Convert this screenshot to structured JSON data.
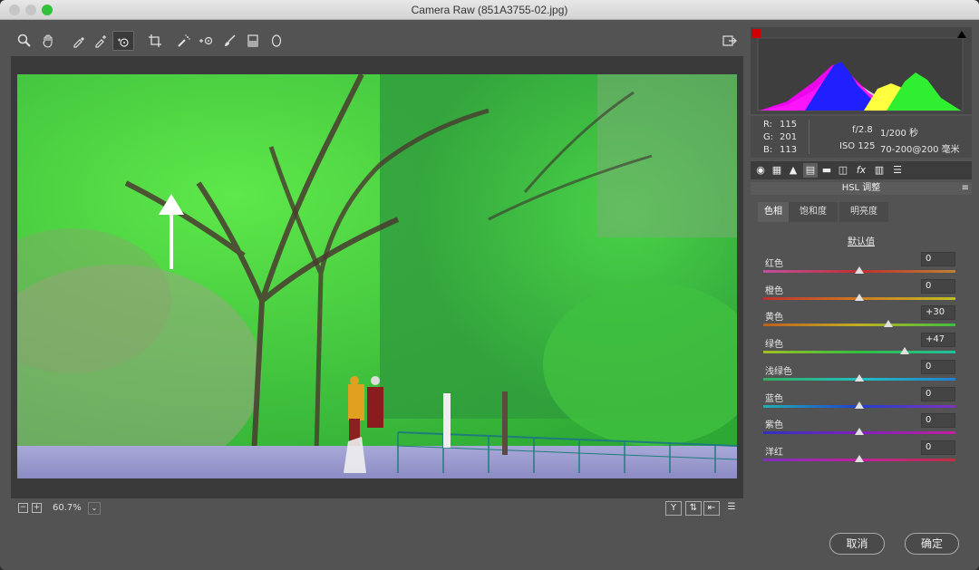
{
  "window": {
    "title": "Camera Raw (851A3755-02.jpg)"
  },
  "toolbar": {
    "tools": [
      "zoom-tool",
      "hand-tool",
      "white-balance-tool",
      "color-sampler-tool",
      "targeted-adjustment-tool",
      "crop-tool",
      "spot-removal-tool",
      "red-eye-tool",
      "adjustment-brush-tool",
      "graduated-filter-tool",
      "radial-filter-tool"
    ],
    "export_icon": "open-export-icon"
  },
  "status": {
    "zoom": "60.7%",
    "zoom_out": "−",
    "zoom_in": "+",
    "compare_y": "Y"
  },
  "readout": {
    "r_label": "R:",
    "r": "115",
    "g_label": "G:",
    "g": "201",
    "b_label": "B:",
    "b": "113",
    "aperture": "f/2.8",
    "shutter": "1/200 秒",
    "iso": "ISO 125",
    "lens": "70-200@200 毫米"
  },
  "panel": {
    "section_title": "HSL 调整",
    "tabs": [
      "色相",
      "饱和度",
      "明亮度"
    ],
    "default_link": "默认值",
    "sliders": [
      {
        "label": "红色",
        "value": "0",
        "level": 0.5,
        "gradient": "linear-gradient(90deg,#c04fa0,#c03030,#c08030)"
      },
      {
        "label": "橙色",
        "value": "0",
        "level": 0.5,
        "gradient": "linear-gradient(90deg,#c03030,#d07a20,#c0c020)"
      },
      {
        "label": "黄色",
        "value": "+30",
        "level": 0.65,
        "gradient": "linear-gradient(90deg,#c06020,#c0b020,#40c040)"
      },
      {
        "label": "绿色",
        "value": "+47",
        "level": 0.735,
        "gradient": "linear-gradient(90deg,#a0c020,#30c040,#20c0a0)"
      },
      {
        "label": "浅绿色",
        "value": "0",
        "level": 0.5,
        "gradient": "linear-gradient(90deg,#30b060,#20c0c0,#2080d0)"
      },
      {
        "label": "蓝色",
        "value": "0",
        "level": 0.5,
        "gradient": "linear-gradient(90deg,#20b0b0,#2040d0,#8030c0)"
      },
      {
        "label": "紫色",
        "value": "0",
        "level": 0.5,
        "gradient": "linear-gradient(90deg,#3030c0,#8020c0,#c020a0)"
      },
      {
        "label": "洋红",
        "value": "0",
        "level": 0.5,
        "gradient": "linear-gradient(90deg,#8030c0,#c020a0,#c03040)"
      }
    ]
  },
  "buttons": {
    "cancel": "取消",
    "ok": "确定"
  }
}
